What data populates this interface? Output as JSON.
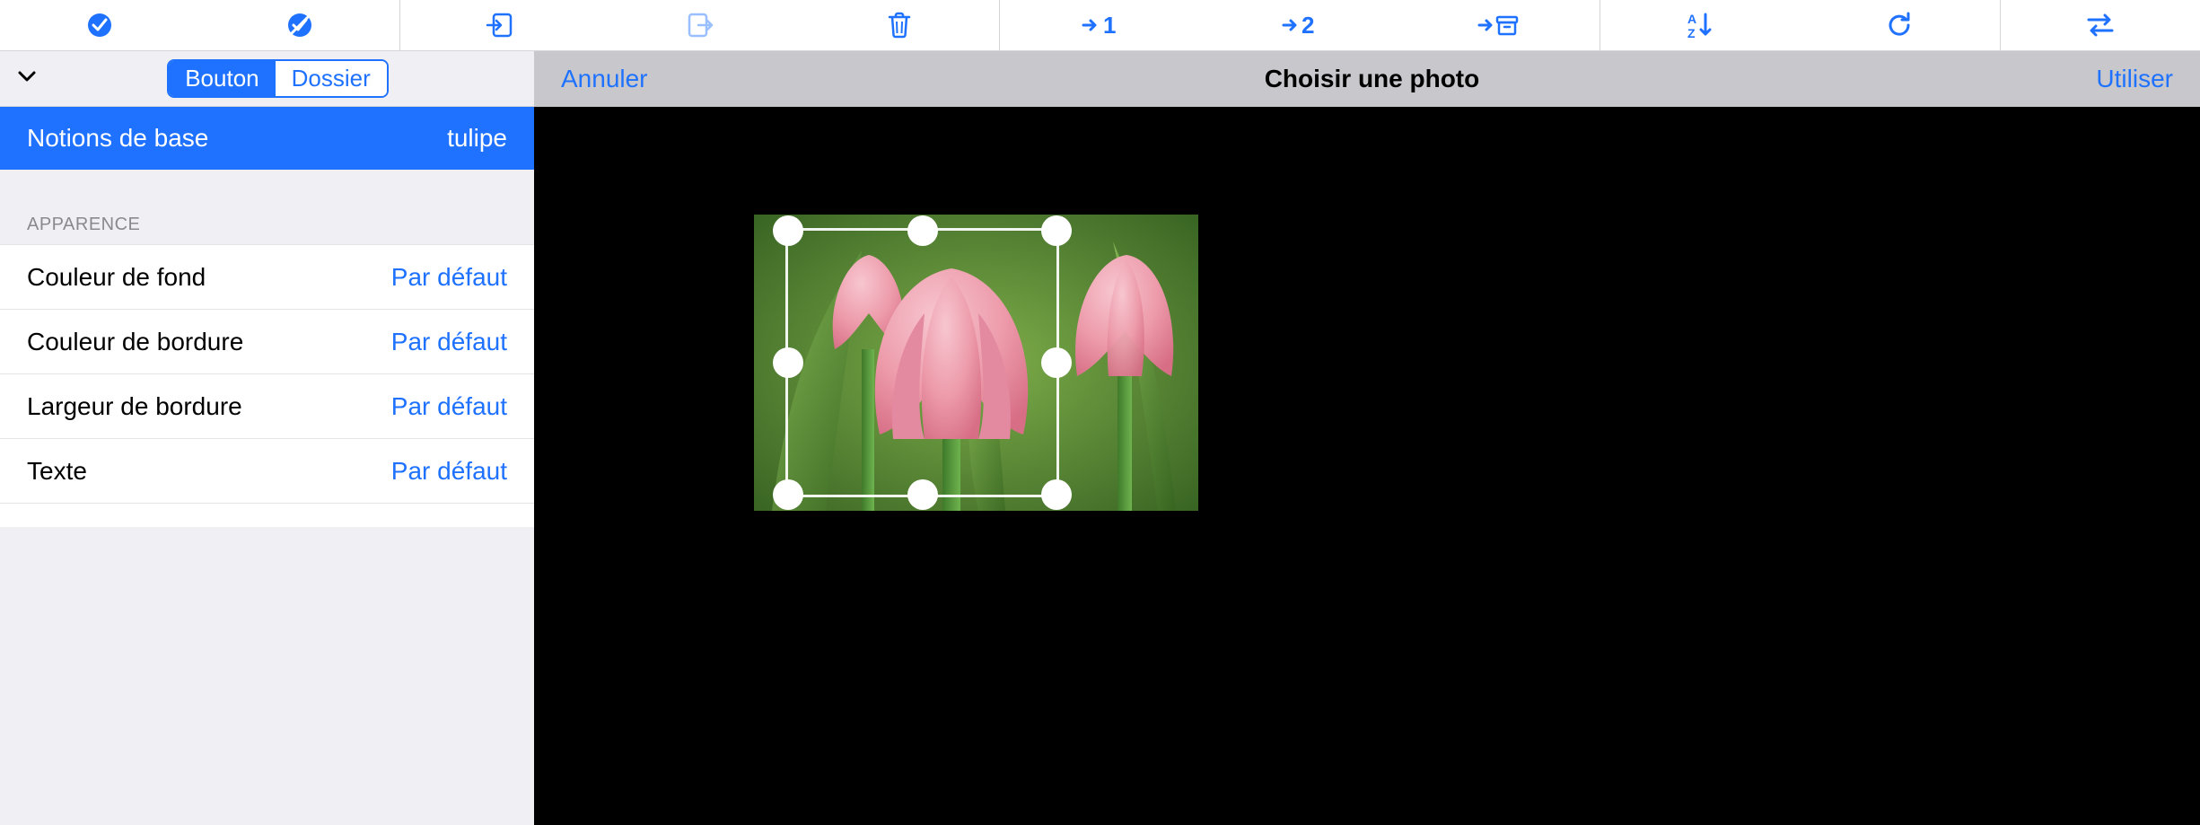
{
  "toolbar": {
    "select_all": "select-all",
    "deselect_all": "deselect-all",
    "import": "import",
    "export": "export",
    "trash": "trash",
    "goto1": "→1",
    "goto2": "→2",
    "archive": "archive",
    "sort": "sort",
    "refresh": "refresh",
    "swap": "swap"
  },
  "left": {
    "segmented": {
      "button": "Bouton",
      "folder": "Dossier",
      "active": "button"
    },
    "selection": {
      "label": "Notions de base",
      "value": "tulipe"
    },
    "section_header": "APPARENCE",
    "rows": [
      {
        "label": "Couleur de fond",
        "value": "Par défaut"
      },
      {
        "label": "Couleur de bordure",
        "value": "Par défaut"
      },
      {
        "label": "Largeur de bordure",
        "value": "Par défaut"
      },
      {
        "label": "Texte",
        "value": "Par défaut"
      }
    ]
  },
  "right": {
    "cancel": "Annuler",
    "title": "Choisir une photo",
    "use": "Utiliser"
  }
}
